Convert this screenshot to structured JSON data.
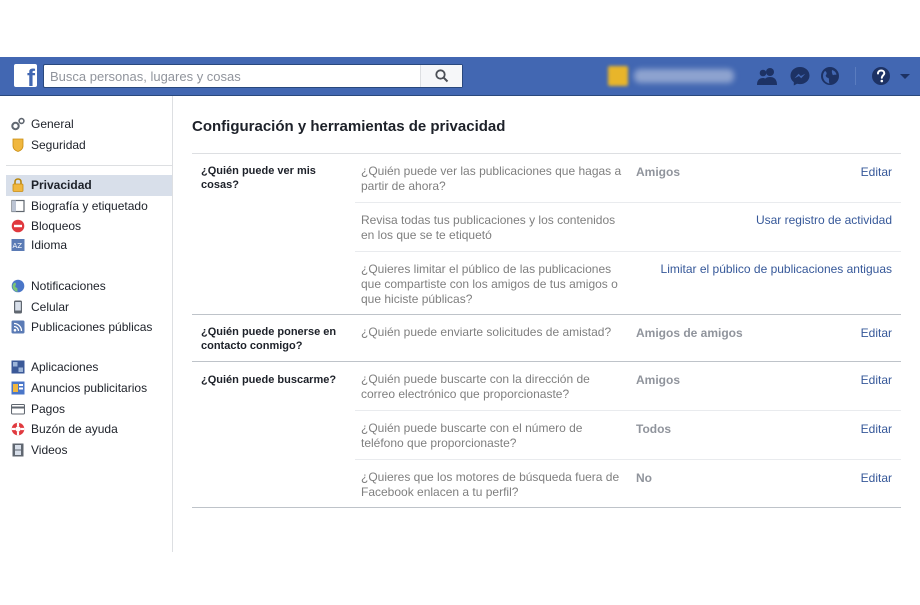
{
  "topbar": {
    "search_placeholder": "Busca personas, lugares y cosas",
    "icons": [
      "facebook-logo",
      "search-icon",
      "friend-requests-icon",
      "messenger-icon",
      "globe-notifications-icon",
      "help-icon",
      "caret-down-icon"
    ],
    "accent": "#4267b2"
  },
  "sidebar": {
    "items": [
      {
        "label": "General",
        "icon": "gear-icon"
      },
      {
        "label": "Seguridad",
        "icon": "shield-icon"
      },
      {
        "label": "Privacidad",
        "icon": "lock-icon",
        "selected": true
      },
      {
        "label": "Biografía y etiquetado",
        "icon": "timeline-icon"
      },
      {
        "label": "Bloqueos",
        "icon": "block-icon"
      },
      {
        "label": "Idioma",
        "icon": "language-icon"
      },
      {
        "label": "Notificaciones",
        "icon": "globe-icon"
      },
      {
        "label": "Celular",
        "icon": "mobile-icon"
      },
      {
        "label": "Publicaciones públicas",
        "icon": "rss-icon"
      },
      {
        "label": "Aplicaciones",
        "icon": "apps-icon"
      },
      {
        "label": "Anuncios publicitarios",
        "icon": "ads-icon"
      },
      {
        "label": "Pagos",
        "icon": "card-icon"
      },
      {
        "label": "Buzón de ayuda",
        "icon": "lifebuoy-icon"
      },
      {
        "label": "Videos",
        "icon": "film-icon"
      }
    ]
  },
  "main": {
    "title": "Configuración y herramientas de privacidad",
    "sections": [
      {
        "label": "¿Quién puede ver mis cosas?",
        "rows": [
          {
            "question": "¿Quién puede ver las publicaciones que hagas a partir de ahora?",
            "value": "Amigos",
            "action": "Editar"
          },
          {
            "question": "Revisa todas tus publicaciones y los contenidos en los que se te etiquetó",
            "value": "",
            "action": "Usar registro de actividad"
          },
          {
            "question": "¿Quieres limitar el público de las publicaciones que compartiste con los amigos de tus amigos o que hiciste públicas?",
            "value": "",
            "action": "Limitar el público de publicaciones antiguas"
          }
        ]
      },
      {
        "label": "¿Quién puede ponerse en contacto conmigo?",
        "rows": [
          {
            "question": "¿Quién puede enviarte solicitudes de amistad?",
            "value": "Amigos de amigos",
            "action": "Editar"
          }
        ]
      },
      {
        "label": "¿Quién puede buscarme?",
        "rows": [
          {
            "question": "¿Quién puede buscarte con la dirección de correo electrónico que proporcionaste?",
            "value": "Amigos",
            "action": "Editar"
          },
          {
            "question": "¿Quién puede buscarte con el número de teléfono que proporcionaste?",
            "value": "Todos",
            "action": "Editar"
          },
          {
            "question": "¿Quieres que los motores de búsqueda fuera de Facebook enlacen a tu perfil?",
            "value": "No",
            "action": "Editar"
          }
        ]
      }
    ]
  }
}
